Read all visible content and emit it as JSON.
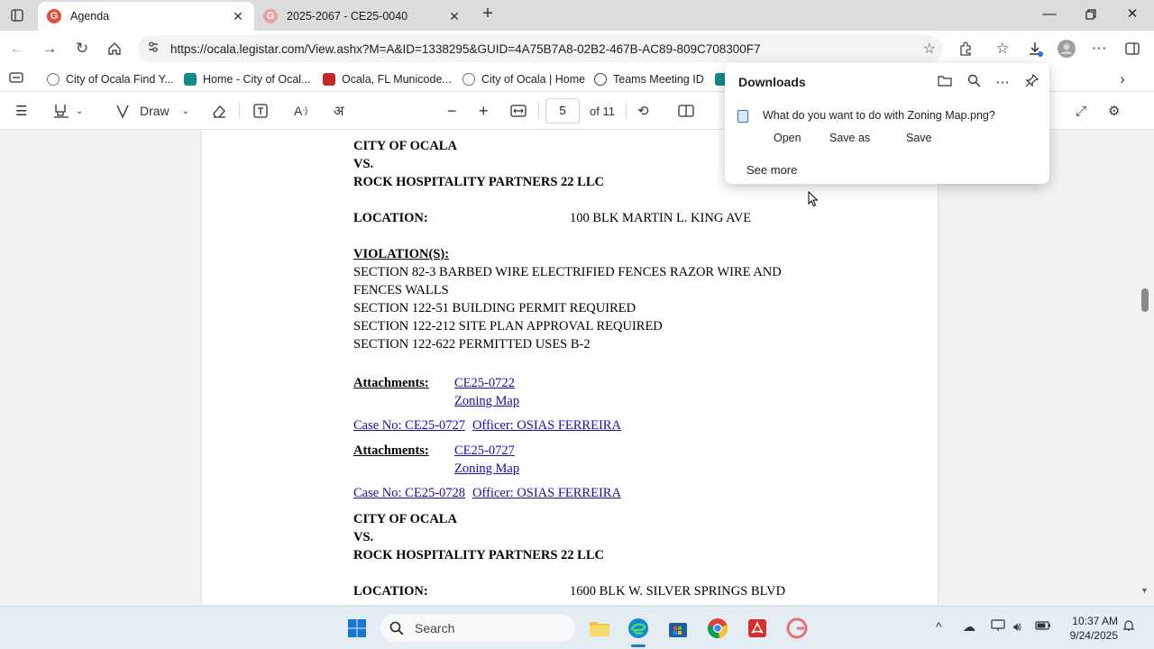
{
  "browser": {
    "tabs": [
      {
        "title": "Agenda",
        "active": true
      },
      {
        "title": "2025-2067 - CE25-0040",
        "active": false
      }
    ],
    "url": "https://ocala.legistar.com/View.ashx?M=A&ID=1338295&GUID=4A75B7A8-02B2-467B-AC89-809C708300F7",
    "favorites": [
      {
        "label": "City of Ocala  Find Y...",
        "icon": "globe-outline-icon"
      },
      {
        "label": "Home - City of Ocal...",
        "icon": "sharepoint-icon"
      },
      {
        "label": "Ocala, FL  Municode...",
        "icon": "municode-icon"
      },
      {
        "label": "City of Ocala | Home",
        "icon": "globe-outline-icon"
      },
      {
        "label": "Teams Meeting ID",
        "icon": "globe-icon"
      }
    ]
  },
  "pdf_toolbar": {
    "draw_label": "Draw",
    "page_number": "5",
    "page_count": "of 11"
  },
  "downloads": {
    "title": "Downloads",
    "question": "What do you want to do with Zoning Map.png?",
    "open_label": "Open",
    "save_as_label": "Save as",
    "save_label": "Save",
    "see_more_label": "See more"
  },
  "document": {
    "case1": {
      "line1": "CITY OF OCALA",
      "line2": "VS.",
      "line3": "ROCK HOSPITALITY PARTNERS 22 LLC",
      "location_label": "LOCATION:",
      "location_value": "100 BLK MARTIN L. KING AVE",
      "violations_label": "VIOLATION(S):",
      "violations": [
        "SECTION 82-3 BARBED WIRE ELECTRIFIED FENCES RAZOR WIRE AND",
        "FENCES WALLS",
        "SECTION 122-51 BUILDING PERMIT REQUIRED",
        "SECTION 122-212 SITE PLAN APPROVAL REQUIRED",
        "SECTION 122-622 PERMITTED USES B-2"
      ],
      "attachments_label": "Attachments:",
      "attachments": [
        "CE25-0722",
        "Zoning Map"
      ]
    },
    "case2": {
      "case_no": "Case No: CE25-0727",
      "officer": "Officer: OSIAS FERREIRA",
      "attachments_label": "Attachments:",
      "attachments": [
        "CE25-0727",
        "Zoning Map"
      ]
    },
    "case3": {
      "case_no": "Case No: CE25-0728",
      "officer": "Officer: OSIAS FERREIRA",
      "line1": "CITY OF OCALA",
      "line2": "VS.",
      "line3": "ROCK HOSPITALITY PARTNERS 22 LLC",
      "location_label": "LOCATION:",
      "location_value": "1600 BLK W. SILVER SPRINGS BLVD"
    }
  },
  "taskbar": {
    "search_label": "Search",
    "time": "10:37 AM",
    "date": "9/24/2025"
  }
}
